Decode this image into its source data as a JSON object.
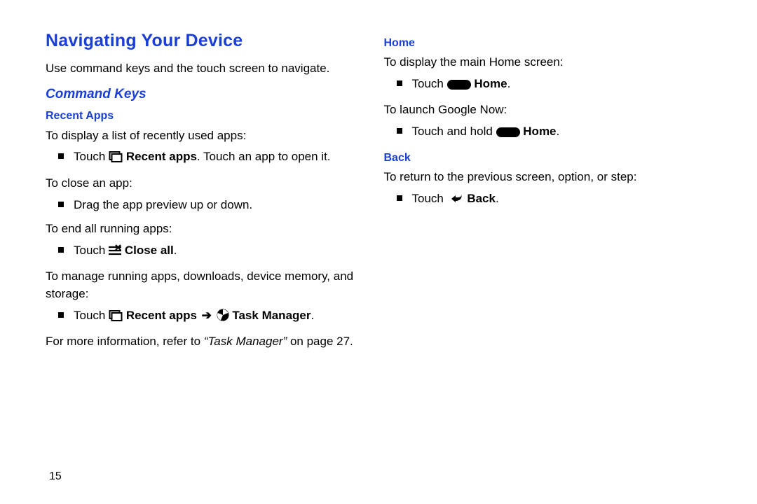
{
  "left": {
    "title": "Navigating Your Device",
    "intro": "Use command keys and the touch screen to navigate.",
    "h2": "Command Keys",
    "recent": {
      "heading": "Recent Apps",
      "p1": "To display a list of recently used apps:",
      "b1_touch": "Touch ",
      "b1_label": "Recent apps",
      "b1_rest": ". Touch an app to open it.",
      "p2": "To close an app:",
      "b2": "Drag the app preview up or down.",
      "p3": "To end all running apps:",
      "b3_touch": "Touch ",
      "b3_label": "Close all",
      "b3_dot": ".",
      "p4": "To manage running apps, downloads, device memory, and storage:",
      "b4_touch": "Touch ",
      "b4_label1": "Recent apps",
      "b4_arrow": " ➔ ",
      "b4_label2": "Task Manager",
      "b4_dot": ".",
      "more1": "For more information, refer to ",
      "more_ref": "“Task Manager”",
      "more2": " on page 27."
    }
  },
  "right": {
    "home": {
      "heading": "Home",
      "p1": "To display the main Home screen:",
      "b1_touch": "Touch ",
      "b1_label": "Home",
      "b1_dot": ".",
      "p2": "To launch Google Now:",
      "b2_touch": "Touch and hold ",
      "b2_label": "Home",
      "b2_dot": "."
    },
    "back": {
      "heading": "Back",
      "p1": "To return to the previous screen, option, or step:",
      "b1_touch": "Touch ",
      "b1_label": "Back",
      "b1_dot": "."
    }
  },
  "pagenum": "15"
}
